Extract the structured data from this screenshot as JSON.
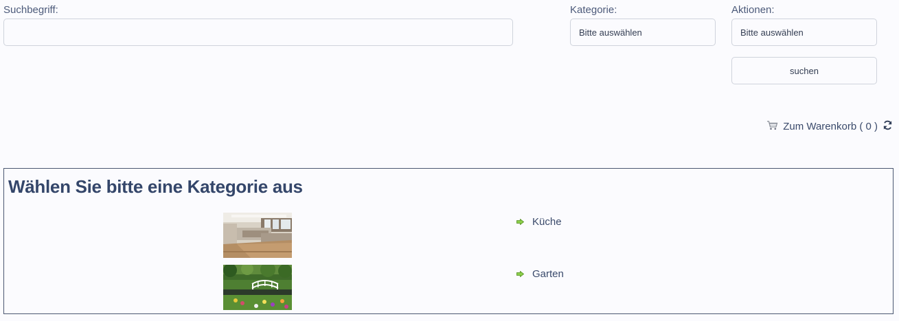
{
  "search": {
    "label": "Suchbegriff:",
    "value": "",
    "placeholder": ""
  },
  "category": {
    "label": "Kategorie:",
    "selected": "Bitte auswählen"
  },
  "actions": {
    "label": "Aktionen:",
    "selected": "Bitte auswählen",
    "search_button": "suchen"
  },
  "cart": {
    "label": "Zum Warenkorb ( 0 )"
  },
  "panel": {
    "title": "Wählen Sie bitte eine Kategorie aus",
    "items": [
      {
        "label": "Küche"
      },
      {
        "label": "Garten"
      }
    ]
  }
}
